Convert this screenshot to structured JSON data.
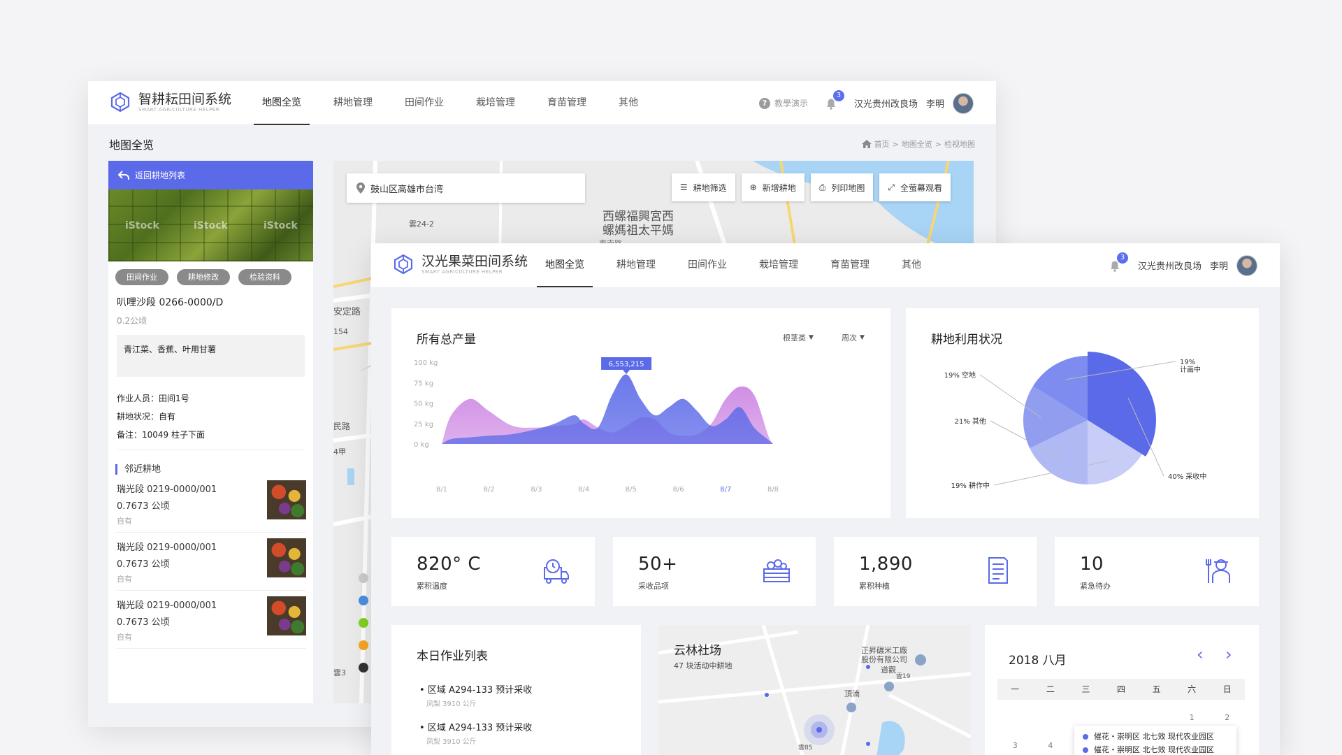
{
  "back": {
    "app_title": "智耕耘田间系统",
    "app_subtitle": "SMART AGRICULTURE HELPER",
    "nav": [
      "地图全览",
      "耕地管理",
      "田间作业",
      "栽培管理",
      "育苗管理",
      "其他"
    ],
    "help": "教學演示",
    "notif_count": "3",
    "farm": "汉光贵州改良场",
    "user": "李明",
    "page_title": "地图全览",
    "breadcrumb": [
      "首页",
      ">",
      "地图全览",
      ">",
      "检视地图"
    ],
    "left": {
      "back_label": "返回耕地列表",
      "watermarks": [
        "iStock",
        "iStock",
        "iStock"
      ],
      "chips": [
        "田间作业",
        "耕地修改",
        "检验资料"
      ],
      "field_name": "叭哩沙段 0266-0000/D",
      "field_area": "0.2公顷",
      "crops": "青江菜、香蕉、叶用甘薯",
      "worker": "作业人员：田间1号",
      "status": "耕地状况：自有",
      "note": "备注：10049 柱子下面",
      "nearby_title": "邻近耕地",
      "nearby": [
        {
          "name": "瑞光段 0219-0000/001",
          "area": "0.7673 公顷",
          "own": "自有"
        },
        {
          "name": "瑞光段 0219-0000/001",
          "area": "0.7673 公顷",
          "own": "自有"
        },
        {
          "name": "瑞光段 0219-0000/001",
          "area": "0.7673 公顷",
          "own": "自有"
        }
      ]
    },
    "map": {
      "search": "鼓山区高雄市台湾",
      "buttons": [
        "耕地筛选",
        "新增耕地",
        "列印地图",
        "全萤幕观看"
      ],
      "labels": [
        "西螺福興宮西",
        "螺媽祖太平媽",
        "安定路",
        "雲24-2",
        "154",
        "民路",
        "4甲",
        "雲3",
        "東南路"
      ],
      "dot_colors": [
        "#cccccc",
        "#4a90e2",
        "#7ed321",
        "#f5a623",
        "#333333"
      ]
    }
  },
  "front": {
    "app_title": "汉光果菜田间系统",
    "app_subtitle": "SMART AGRICULTURE HELPER",
    "nav": [
      "地图全览",
      "耕地管理",
      "田间作业",
      "栽培管理",
      "育苗管理",
      "其他"
    ],
    "notif_count": "3",
    "farm": "汉光贵州改良场",
    "user": "李明",
    "yield_title": "所有总产量",
    "filter_1": "根茎类",
    "filter_2": "周次",
    "tooltip": "6,553,215",
    "usage_title": "耕地利用状况",
    "stats": [
      {
        "value": "820° C",
        "label": "累积温度"
      },
      {
        "value": "50+",
        "label": "采收品项"
      },
      {
        "value": "1,890",
        "label": "累积种植"
      },
      {
        "value": "10",
        "label": "紧急待办"
      }
    ],
    "tasks_title": "本日作业列表",
    "tasks": [
      {
        "title": "区域 A294-133 预计采收",
        "sub": "凤梨 3910 公斤"
      },
      {
        "title": "区域 A294-133 预计采收",
        "sub": "凤梨 3910 公斤"
      }
    ],
    "farm_map": {
      "title": "云林社场",
      "sub": "47 块活动中耕地",
      "labels": [
        "正昇碾米工廠",
        "股份有限公司",
        "道觀",
        "頂湳",
        "雲19",
        "雲85"
      ]
    },
    "calendar": {
      "title": "2018 八月",
      "weekdays": [
        "一",
        "二",
        "三",
        "四",
        "五",
        "六",
        "日"
      ],
      "row1": [
        "",
        "",
        "",
        "",
        "",
        "1",
        "2"
      ],
      "row2": [
        "3",
        "4",
        "",
        "",
        "",
        "",
        ""
      ],
      "events": [
        "催花・崇明区 北七效 现代农业园区",
        "催花・崇明区 北七效 现代农业园区"
      ]
    },
    "accent": "#5b6ae8"
  },
  "chart_data": [
    {
      "type": "area",
      "title": "所有总产量",
      "categories": [
        "8/1",
        "8/2",
        "8/3",
        "8/4",
        "8/5",
        "8/6",
        "8/7",
        "8/8"
      ],
      "y_ticks": [
        "100 kg",
        "75 kg",
        "50 kg",
        "25 kg",
        "0 kg"
      ],
      "ylim": [
        0,
        100
      ],
      "x": [
        1,
        1.2,
        1.6,
        2,
        2.5,
        3,
        3.4,
        3.8,
        4,
        4.3,
        4.6,
        4.9,
        5.2,
        5.5,
        5.8,
        6.1,
        6.4,
        6.7,
        7,
        7.3,
        7.6,
        7.9,
        8
      ],
      "series": [
        {
          "color": "#c87be0",
          "values": [
            0,
            35,
            55,
            40,
            22,
            20,
            22,
            24,
            30,
            20,
            14,
            22,
            32,
            30,
            14,
            10,
            12,
            25,
            55,
            70,
            60,
            10,
            0
          ]
        },
        {
          "color": "#5b6ae8",
          "values": [
            0,
            6,
            8,
            10,
            12,
            18,
            25,
            35,
            25,
            20,
            60,
            85,
            55,
            35,
            45,
            55,
            40,
            22,
            30,
            45,
            20,
            5,
            0
          ]
        }
      ],
      "highlight": {
        "x": 4.9,
        "label": "6,553,215"
      },
      "legend": "none",
      "grid": false
    },
    {
      "type": "pie",
      "title": "耕地利用状况",
      "slices": [
        {
          "label": "40% 采收中",
          "value": 40,
          "color": "#5b6ae8"
        },
        {
          "label": "19% 耕作中",
          "value": 19,
          "color": "#c8cdf7"
        },
        {
          "label": "21% 其他",
          "value": 21,
          "color": "#b1b9f4"
        },
        {
          "label": "19% 空地",
          "value": 19,
          "color": "#919ef0"
        },
        {
          "label": "19% 计画中",
          "value": 19,
          "color": "#7d8cee"
        }
      ]
    }
  ]
}
